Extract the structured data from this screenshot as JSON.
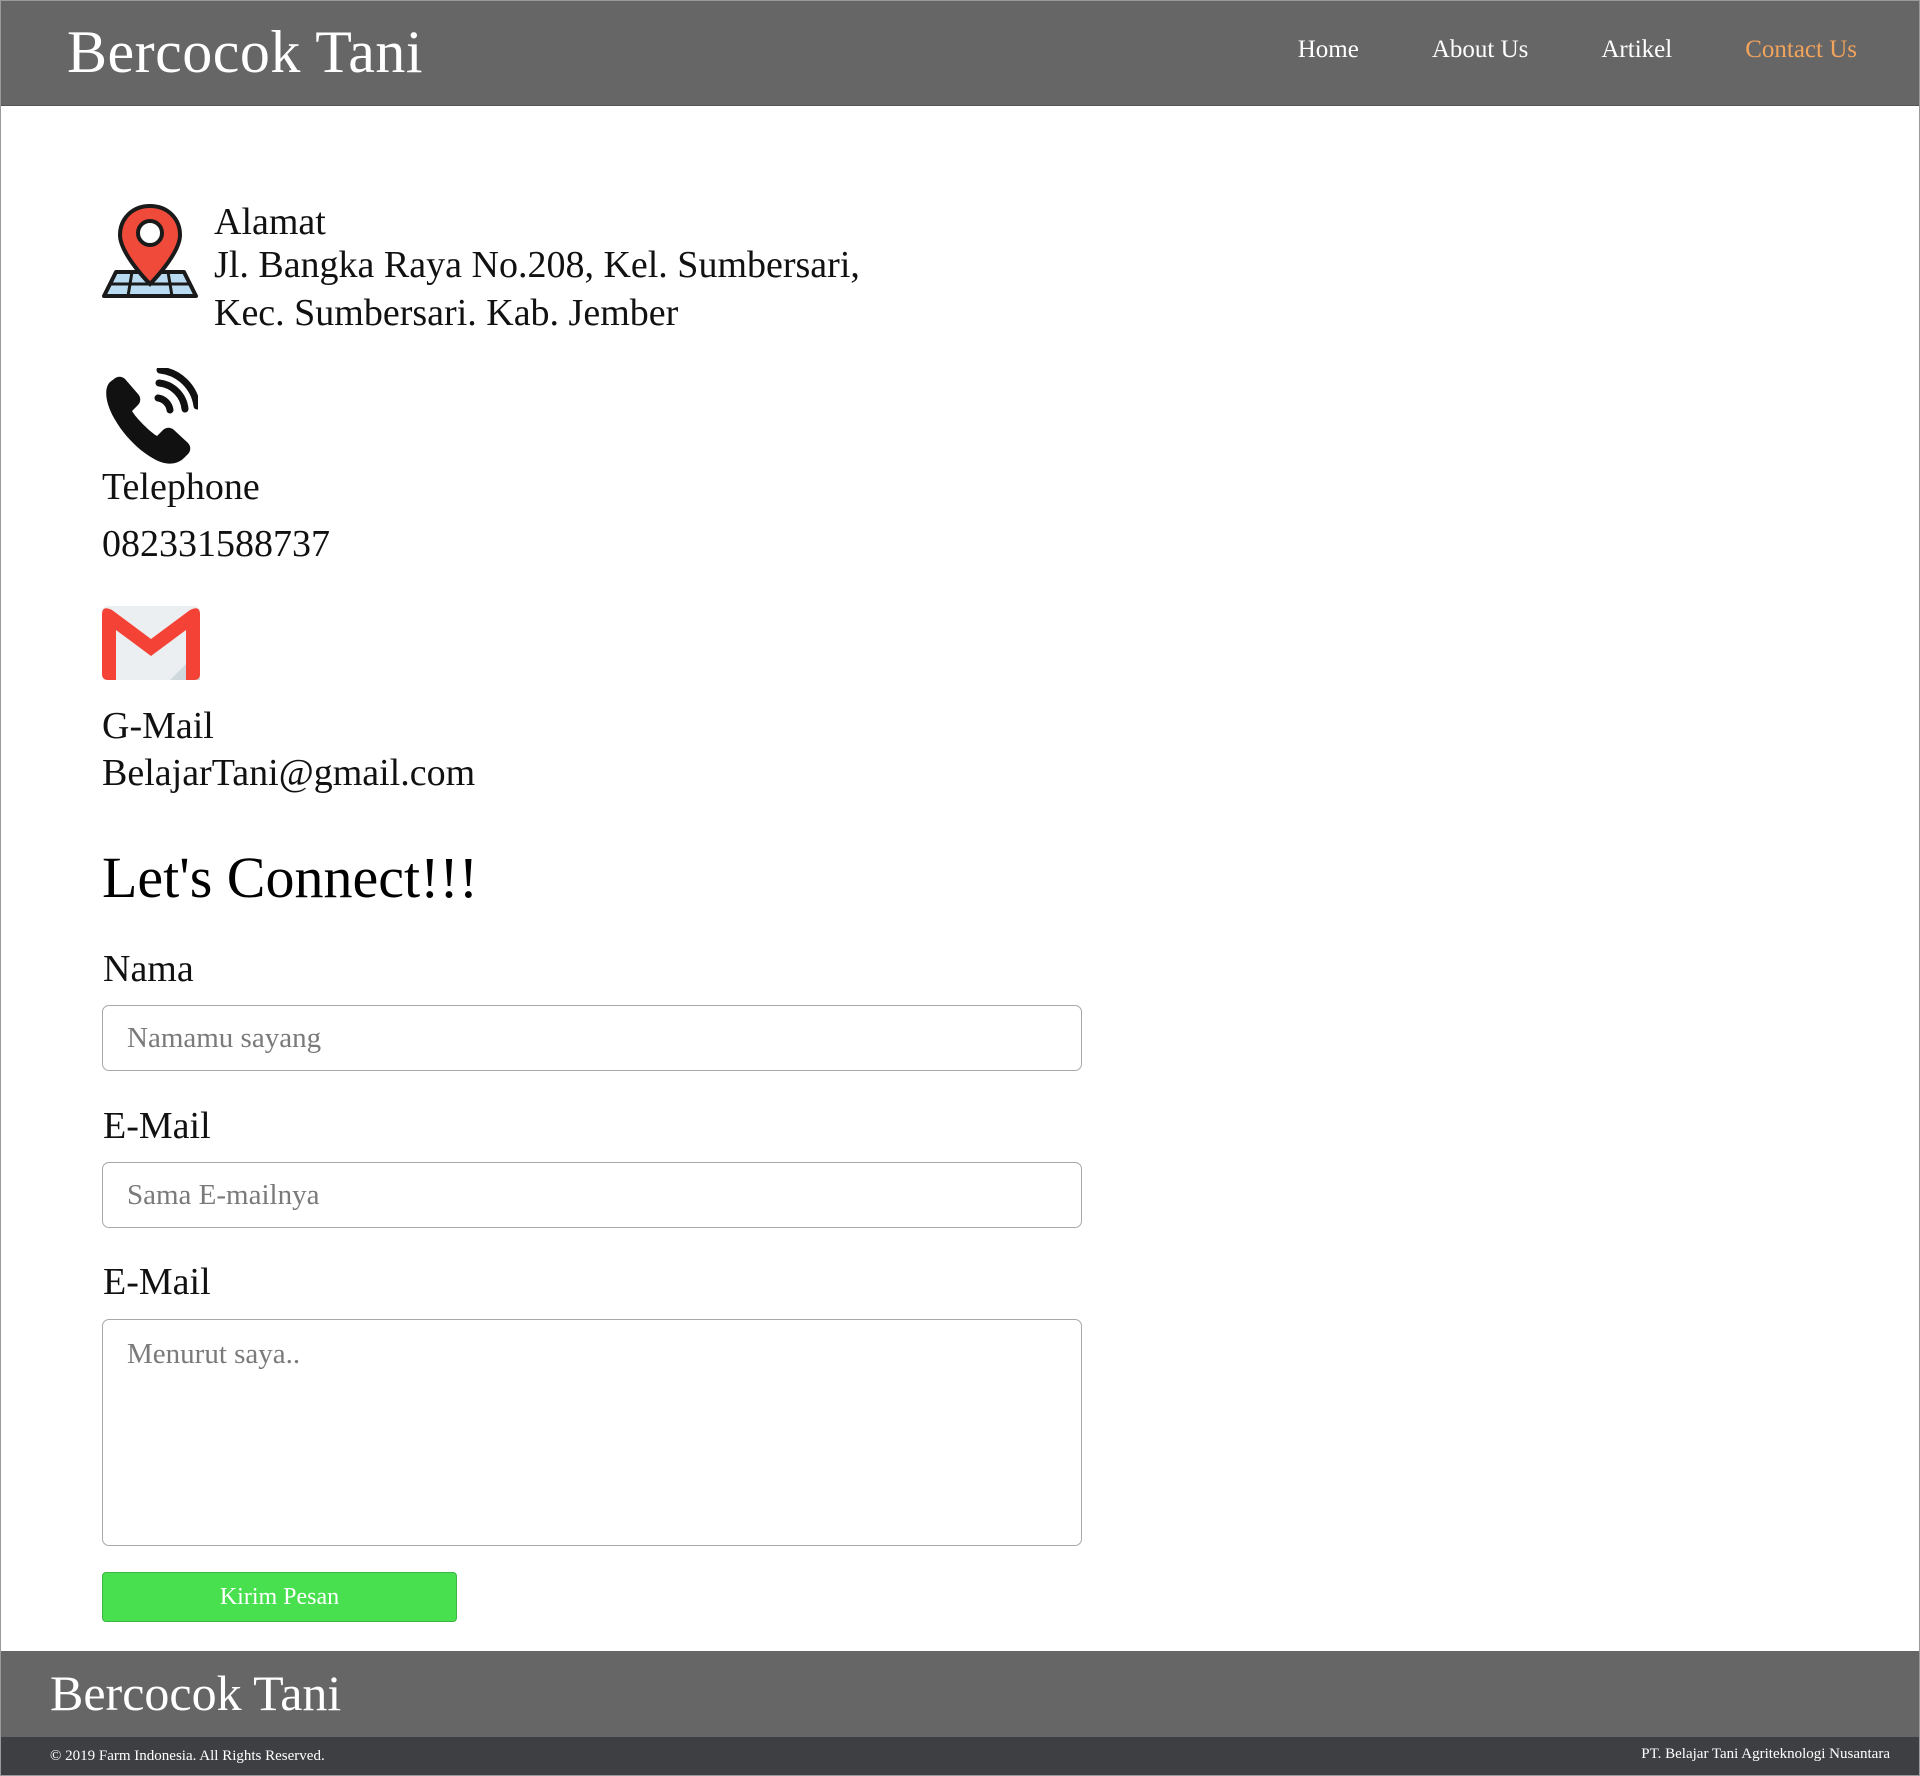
{
  "header": {
    "brand": "Bercocok Tani",
    "nav": [
      {
        "label": "Home"
      },
      {
        "label": "About Us"
      },
      {
        "label": "Artikel"
      },
      {
        "label": "Contact Us",
        "active": true
      }
    ],
    "active_color": "#f2a35c",
    "bar_color": "#666666"
  },
  "contact": {
    "address": {
      "icon": "map-pin-icon",
      "title": "Alamat",
      "line1": "Jl. Bangka Raya No.208, Kel. Sumbersari,",
      "line2": "Kec. Sumbersari. Kab. Jember"
    },
    "phone": {
      "icon": "phone-icon",
      "title": "Telephone",
      "value": "082331588737"
    },
    "gmail": {
      "icon": "gmail-icon",
      "title": "G-Mail",
      "value": "BelajarTani@gmail.com"
    }
  },
  "form": {
    "heading": "Let's Connect!!!",
    "name_label": "Nama",
    "name_placeholder": "Namamu sayang",
    "email_label": "E-Mail",
    "email_placeholder": "Sama E-mailnya",
    "message_label": "E-Mail",
    "message_placeholder": "Menurut saya..",
    "submit_label": "Kirim Pesan",
    "submit_color": "#48e04f"
  },
  "footer": {
    "brand": "Bercocok Tani",
    "copyright": "© 2019 Farm Indonesia. All Rights Reserved.",
    "company": "PT. Belajar Tani Agriteknologi Nusantara"
  }
}
